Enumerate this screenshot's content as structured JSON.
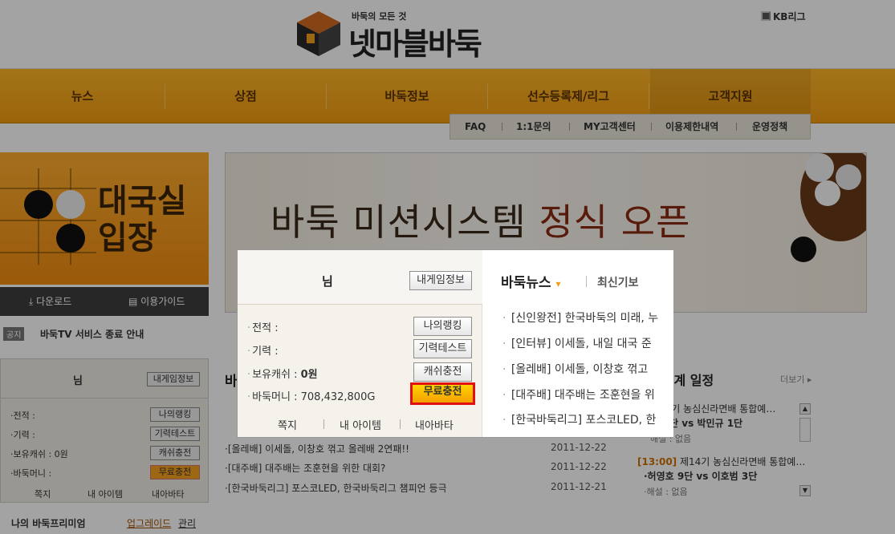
{
  "header": {
    "logo_tagline": "바둑의 모든 것",
    "logo_name": "넷마블바둑",
    "partner_link": "KB리그"
  },
  "nav": {
    "items": [
      "뉴스",
      "상점",
      "바둑정보",
      "선수등록제/리그",
      "고객지원"
    ],
    "sub_items": [
      "FAQ",
      "1:1문의",
      "MY고객센터",
      "이용제한내역",
      "운영정책"
    ]
  },
  "left": {
    "enter_line1": "대국실",
    "enter_line2": "입장",
    "download": "다운로드",
    "guide": "이용가이드",
    "notice_tag": "공지",
    "notice_text": "바둑TV 서비스 종료 안내"
  },
  "banner": {
    "title_main": "바둑 미션시스템 ",
    "title_accent": "정식 오픈"
  },
  "userbox": {
    "name_suffix": "님",
    "my_game_info": "내게임정보",
    "stats": [
      {
        "label": "·전적 :",
        "button": "나의랭킹"
      },
      {
        "label": "·기력 :",
        "button": "기력테스트"
      },
      {
        "label": "·보유캐쉬 : 0원",
        "button": "캐쉬충전"
      },
      {
        "label": "·바둑머니 :",
        "button": "무료충전"
      }
    ],
    "footer": [
      "쪽지",
      "내 아이템",
      "내아바타"
    ],
    "premium_label": "나의 바둑프리미엄",
    "upgrade": "업그레이드",
    "manage": "관리"
  },
  "bg_news": {
    "heading_prefix": "바",
    "rows": [
      {
        "text": "[올레배] 이세돌, 이창호 꺾고 올레배 2연패!!",
        "date": "2011-12-22"
      },
      {
        "text": "[대주배] 대주배는 조훈현을 위한 대회?",
        "date": "2011-12-22"
      },
      {
        "text": "[한국바둑리그] 포스코LED, 한국바둑리그 챔피언 등극",
        "date": "2011-12-21"
      }
    ]
  },
  "live": {
    "title": "생중계 일정",
    "more": "더보기",
    "items": [
      {
        "event": "제14기 농심신라면배 통합예…",
        "players": "·? 9단 vs 박민규 1단",
        "commentary": "해설 : 없음"
      },
      {
        "time": "[13:00]",
        "event": "제14기 농심신라면배 통합예…",
        "players": "·허영호 9단 vs 이호범 3단",
        "commentary": "·해설 : 없음"
      }
    ]
  },
  "spotlight": {
    "name_suffix": "님",
    "my_game_info": "내게임정보",
    "stats": [
      {
        "label": "전적 :",
        "button": "나의랭킹"
      },
      {
        "label": "기력 :",
        "button": "기력테스트"
      },
      {
        "label": "보유캐쉬 : ",
        "value": "0원",
        "button": "캐쉬충전"
      },
      {
        "label": "바둑머니 : ",
        "value": "708,432,800G",
        "button": "무료충전"
      }
    ],
    "footer": [
      "쪽지",
      "내 아이템",
      "내아바타"
    ],
    "news_tab": "바둑뉴스",
    "news_tab2": "최신기보",
    "news": [
      "[신인왕전] 한국바둑의 미래, 누",
      "[인터뷰] 이세돌, 내일 대국 준",
      "[올레배] 이세돌, 이창호 꺾고",
      "[대주배] 대주배는 조훈현을 위",
      "[한국바둑리그] 포스코LED, 한"
    ]
  }
}
